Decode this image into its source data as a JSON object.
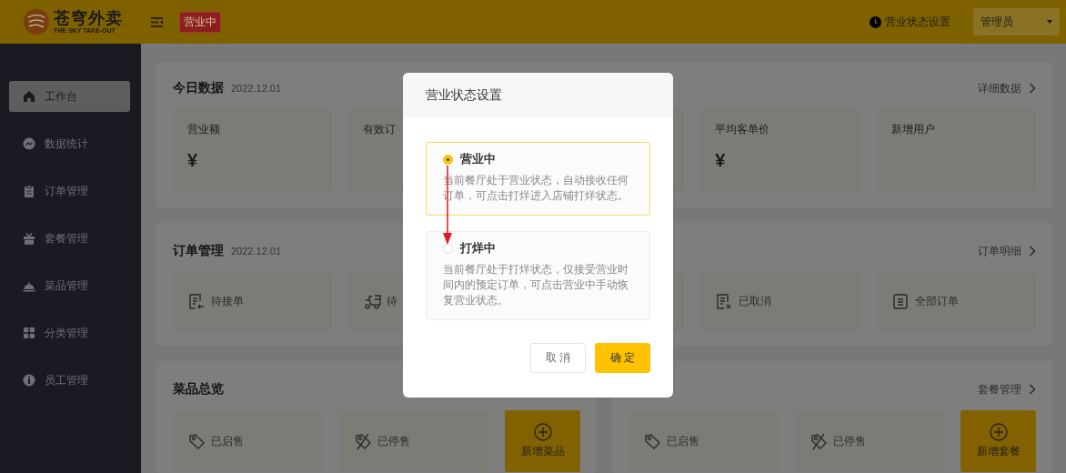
{
  "header": {
    "logo": {
      "title": "苍穹外卖",
      "subtitle": "THE SKY TAKE-OUT"
    },
    "status_badge": "营业中",
    "status_setting": "营业状态设置",
    "user_menu": "管理员"
  },
  "sidebar": {
    "items": [
      {
        "label": "工作台",
        "selected": true
      },
      {
        "label": "数据统计",
        "selected": false
      },
      {
        "label": "订单管理",
        "selected": false
      },
      {
        "label": "套餐管理",
        "selected": false
      },
      {
        "label": "菜品管理",
        "selected": false
      },
      {
        "label": "分类管理",
        "selected": false
      },
      {
        "label": "员工管理",
        "selected": false
      }
    ]
  },
  "today": {
    "title": "今日数据",
    "date": "2022.12.01",
    "link": "详细数据",
    "cards": [
      {
        "kind": "stat",
        "label": "营业额",
        "value": "¥"
      },
      {
        "kind": "stat",
        "label": "有效订"
      },
      {
        "kind": "covered"
      },
      {
        "kind": "stat",
        "label": "平均客单价",
        "value": "¥"
      },
      {
        "kind": "stat",
        "label": "新增用户"
      }
    ]
  },
  "orders": {
    "title": "订单管理",
    "date": "2022.12.01",
    "link": "订单明细",
    "cards": [
      {
        "kind": "order",
        "label": "待接单"
      },
      {
        "kind": "order",
        "label": "待"
      },
      {
        "kind": "covered"
      },
      {
        "kind": "order",
        "label": "已取消"
      },
      {
        "kind": "order",
        "label": "全部订单"
      }
    ]
  },
  "dishes": {
    "title": "菜品总览",
    "cards": [
      {
        "label": "已启售"
      },
      {
        "label": "已停售"
      }
    ],
    "add": "新增菜品"
  },
  "setmeals": {
    "link": "套餐管理",
    "cards": [
      {
        "label": "已启售"
      },
      {
        "label": "已停售"
      }
    ],
    "add": "新增套餐"
  },
  "dialog": {
    "title": "营业状态设置",
    "options": [
      {
        "label": "营业中",
        "description": "当前餐厅处于营业状态，自动接收任何订单，可点击打烊进入店铺打烊状态。",
        "selected": true
      },
      {
        "label": "打烊中",
        "description": "当前餐厅处于打烊状态，仅接受营业时间内的预定订单，可点击营业中手动恢复营业状态。",
        "selected": false
      }
    ],
    "buttons": [
      {
        "label": "取 消",
        "kind": "secondary"
      },
      {
        "label": "确 定",
        "kind": "primary"
      }
    ]
  }
}
